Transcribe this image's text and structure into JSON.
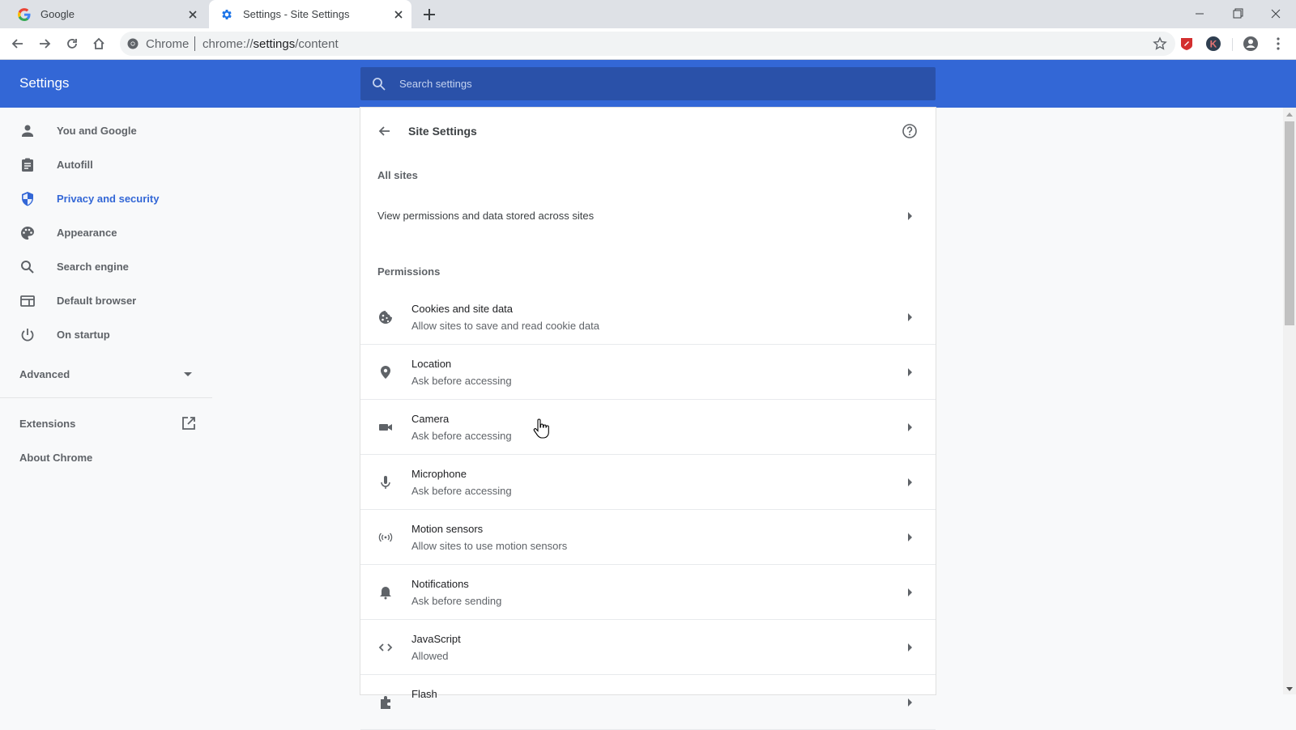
{
  "browser": {
    "tabs": [
      {
        "title": "Google",
        "icon": "google-g-icon",
        "active": false
      },
      {
        "title": "Settings - Site Settings",
        "icon": "gear-icon",
        "active": true
      }
    ],
    "omnibox": {
      "chip": "Chrome",
      "url_prefix": "chrome://",
      "url_host": "settings",
      "url_path": "/content"
    },
    "extensions": [
      "shield-extension-icon",
      "k-extension-icon"
    ],
    "colors": {
      "accent": "#3367d6",
      "search_bg": "#2a51a9",
      "ext_red": "#d32f2f",
      "ext_dark": "#2f3e50"
    }
  },
  "settings": {
    "header_title": "Settings",
    "search_placeholder": "Search settings",
    "sidebar": {
      "items": [
        {
          "label": "You and Google",
          "icon": "person-icon"
        },
        {
          "label": "Autofill",
          "icon": "clipboard-icon"
        },
        {
          "label": "Privacy and security",
          "icon": "shield-icon",
          "selected": true
        },
        {
          "label": "Appearance",
          "icon": "palette-icon"
        },
        {
          "label": "Search engine",
          "icon": "search-icon"
        },
        {
          "label": "Default browser",
          "icon": "browser-window-icon"
        },
        {
          "label": "On startup",
          "icon": "power-icon"
        }
      ],
      "advanced": "Advanced",
      "extensions": "Extensions",
      "about": "About Chrome"
    },
    "page": {
      "title": "Site Settings",
      "all_sites_heading": "All sites",
      "all_sites_link": "View permissions and data stored across sites",
      "permissions_heading": "Permissions",
      "permissions": [
        {
          "title": "Cookies and site data",
          "subtitle": "Allow sites to save and read cookie data",
          "icon": "cookie-icon"
        },
        {
          "title": "Location",
          "subtitle": "Ask before accessing",
          "icon": "location-pin-icon"
        },
        {
          "title": "Camera",
          "subtitle": "Ask before accessing",
          "icon": "camera-icon"
        },
        {
          "title": "Microphone",
          "subtitle": "Ask before accessing",
          "icon": "microphone-icon"
        },
        {
          "title": "Motion sensors",
          "subtitle": "Allow sites to use motion sensors",
          "icon": "motion-sensor-icon"
        },
        {
          "title": "Notifications",
          "subtitle": "Ask before sending",
          "icon": "bell-icon"
        },
        {
          "title": "JavaScript",
          "subtitle": "Allowed",
          "icon": "code-icon"
        },
        {
          "title": "Flash",
          "subtitle": "",
          "icon": "puzzle-icon"
        }
      ]
    }
  }
}
